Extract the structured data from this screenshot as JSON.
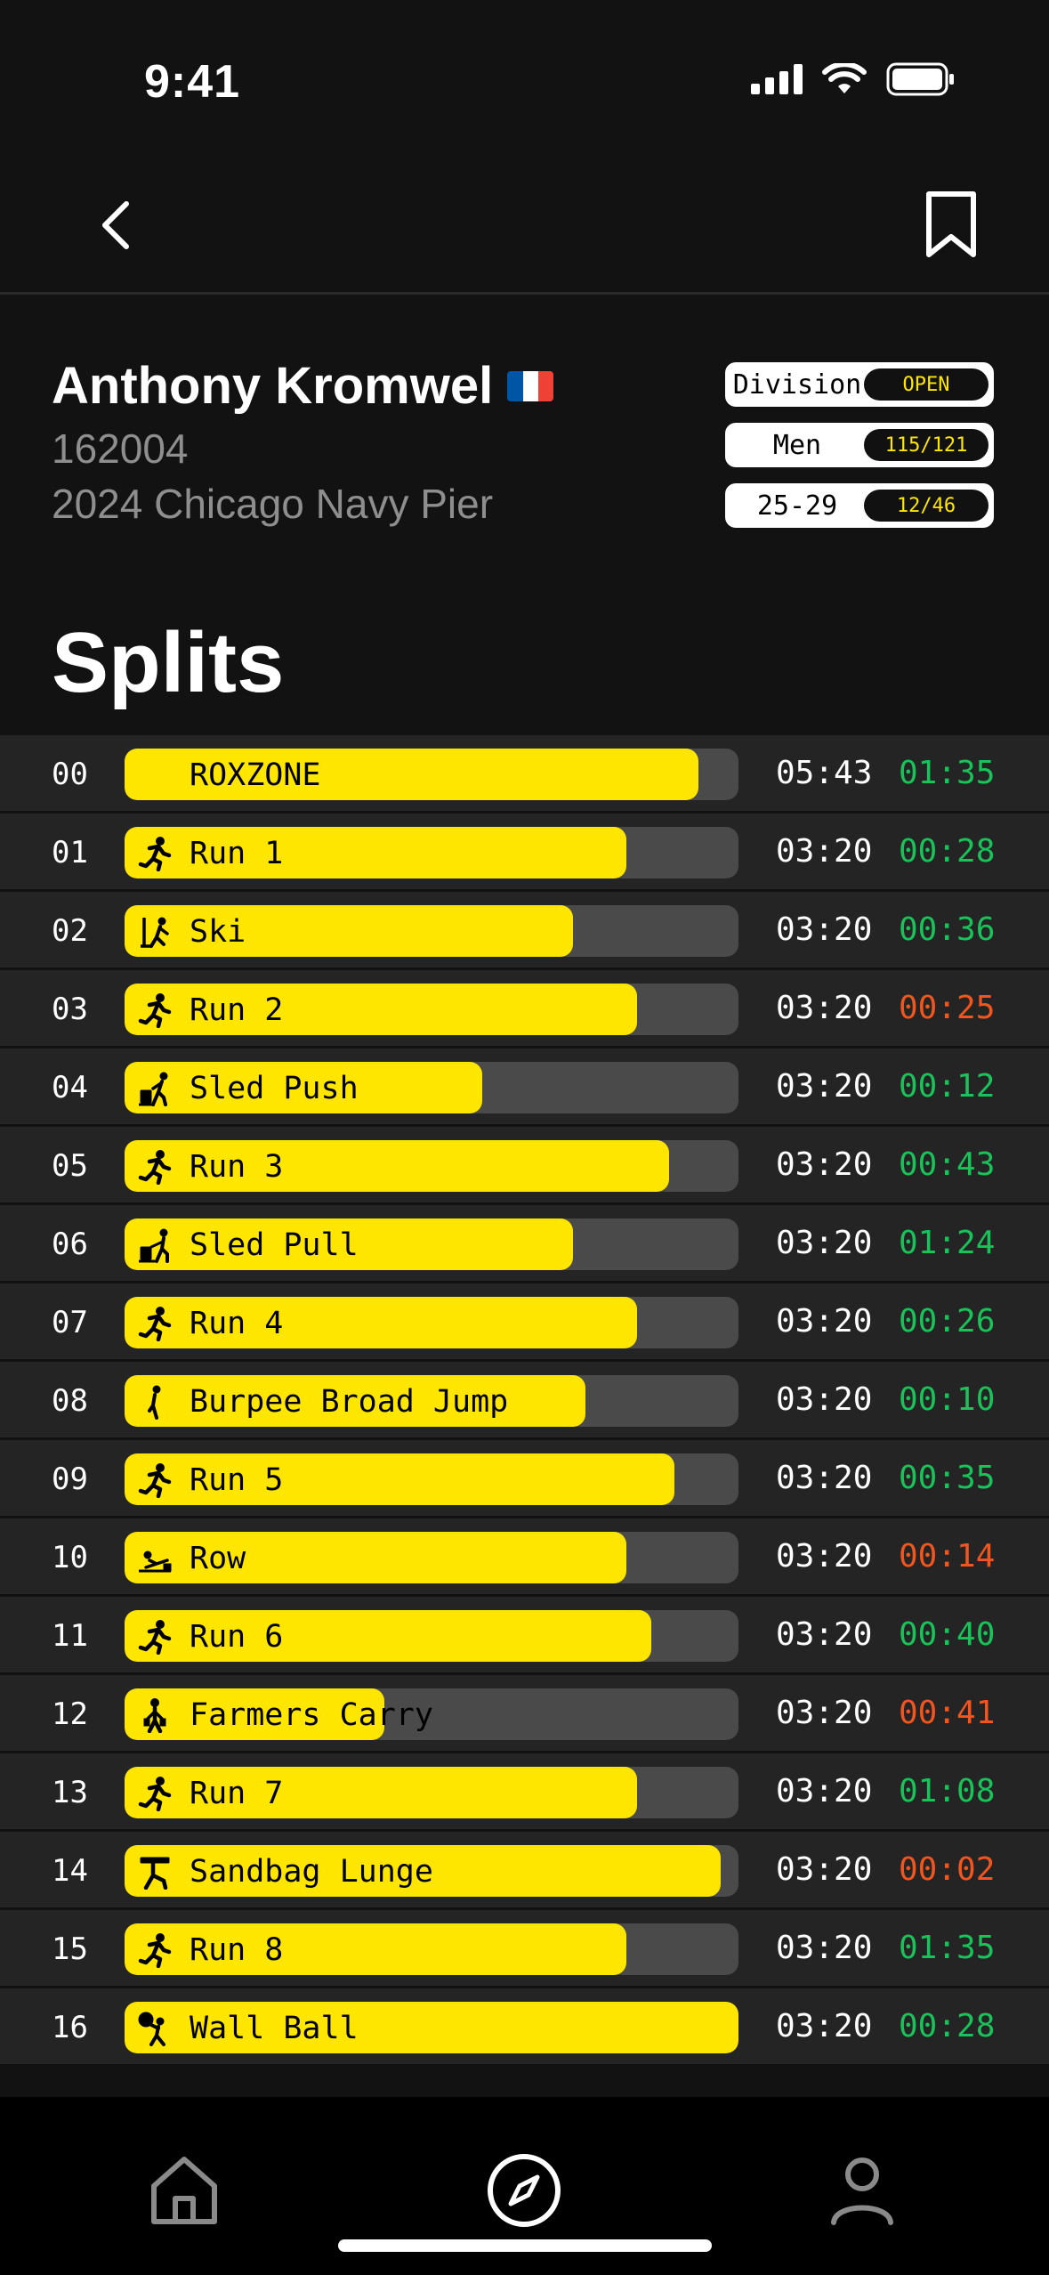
{
  "status_bar": {
    "time": "9:41"
  },
  "athlete": {
    "name": "Anthony Kromwel",
    "bib": "162004",
    "event": "2024 Chicago Navy Pier",
    "flag_colors": [
      "#0055A4",
      "#FFFFFF",
      "#EF4135"
    ]
  },
  "badges": [
    {
      "label": "Division",
      "value": "OPEN"
    },
    {
      "label": "Men",
      "value": "115/121"
    },
    {
      "label": "25-29",
      "value": "12/46"
    }
  ],
  "section_title": "Splits",
  "colors": {
    "accent": "#FFE600",
    "good": "#19C35A",
    "bad": "#F2551E",
    "track": "#4A4A4A"
  },
  "splits": [
    {
      "idx": "00",
      "icon": "none",
      "name": "ROXZONE",
      "target": "05:43",
      "actual": "01:35",
      "status": "good",
      "fill": 0.935
    },
    {
      "idx": "01",
      "icon": "run-icon",
      "name": "Run 1",
      "target": "03:20",
      "actual": "00:28",
      "status": "good",
      "fill": 0.817
    },
    {
      "idx": "02",
      "icon": "ski-icon",
      "name": "Ski",
      "target": "03:20",
      "actual": "00:36",
      "status": "good",
      "fill": 0.73
    },
    {
      "idx": "03",
      "icon": "run-icon",
      "name": "Run 2",
      "target": "03:20",
      "actual": "00:25",
      "status": "bad",
      "fill": 0.835
    },
    {
      "idx": "04",
      "icon": "sled-push-icon",
      "name": "Sled Push",
      "target": "03:20",
      "actual": "00:12",
      "status": "good",
      "fill": 0.582
    },
    {
      "idx": "05",
      "icon": "run-icon",
      "name": "Run 3",
      "target": "03:20",
      "actual": "00:43",
      "status": "good",
      "fill": 0.887
    },
    {
      "idx": "06",
      "icon": "sled-pull-icon",
      "name": "Sled Pull",
      "target": "03:20",
      "actual": "01:24",
      "status": "good",
      "fill": 0.73
    },
    {
      "idx": "07",
      "icon": "run-icon",
      "name": "Run 4",
      "target": "03:20",
      "actual": "00:26",
      "status": "good",
      "fill": 0.835
    },
    {
      "idx": "08",
      "icon": "burpee-icon",
      "name": "Burpee Broad Jump",
      "target": "03:20",
      "actual": "00:10",
      "status": "good",
      "fill": 0.751
    },
    {
      "idx": "09",
      "icon": "run-icon",
      "name": "Run 5",
      "target": "03:20",
      "actual": "00:35",
      "status": "good",
      "fill": 0.896
    },
    {
      "idx": "10",
      "icon": "row-icon",
      "name": "Row",
      "target": "03:20",
      "actual": "00:14",
      "status": "bad",
      "fill": 0.817
    },
    {
      "idx": "11",
      "icon": "run-icon",
      "name": "Run 6",
      "target": "03:20",
      "actual": "00:40",
      "status": "good",
      "fill": 0.858
    },
    {
      "idx": "12",
      "icon": "farmers-carry-icon",
      "name": "Farmers Carry",
      "target": "03:20",
      "actual": "00:41",
      "status": "bad",
      "fill": 0.423
    },
    {
      "idx": "13",
      "icon": "run-icon",
      "name": "Run 7",
      "target": "03:20",
      "actual": "01:08",
      "status": "good",
      "fill": 0.835
    },
    {
      "idx": "14",
      "icon": "sandbag-lunge-icon",
      "name": "Sandbag Lunge",
      "target": "03:20",
      "actual": "00:02",
      "status": "bad",
      "fill": 0.971
    },
    {
      "idx": "15",
      "icon": "run-icon",
      "name": "Run 8",
      "target": "03:20",
      "actual": "01:35",
      "status": "good",
      "fill": 0.817
    },
    {
      "idx": "16",
      "icon": "wall-ball-icon",
      "name": "Wall Ball",
      "target": "03:20",
      "actual": "00:28",
      "status": "good",
      "fill": 1.0
    }
  ],
  "tabs": [
    {
      "name": "home",
      "icon": "home-icon",
      "active": false
    },
    {
      "name": "explore",
      "icon": "compass-icon",
      "active": true
    },
    {
      "name": "profile",
      "icon": "person-icon",
      "active": false
    }
  ]
}
